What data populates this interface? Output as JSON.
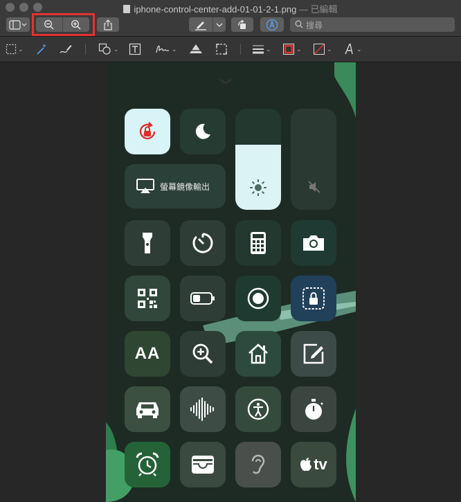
{
  "window": {
    "title": "iphone-control-center-add-01-01-2-1.png",
    "status": " — 已編輯"
  },
  "toolbar": {
    "search_placeholder": "搜尋",
    "highlight_color": "#e33232"
  },
  "control_center": {
    "mirror_label": "螢幕鏡像輸出",
    "rows": [
      [
        "flashlight-icon",
        "timer-icon",
        "calculator-icon",
        "camera-icon"
      ],
      [
        "qr-code-icon",
        "low-power-mode-icon",
        "screen-recording-icon",
        "guided-access-icon"
      ],
      [
        "text-size-icon",
        "magnifier-icon",
        "home-icon",
        "notes-icon"
      ],
      [
        "car-icon",
        "sound-recognition-icon",
        "accessibility-icon",
        "stopwatch-icon"
      ],
      [
        "alarm-icon",
        "wallet-icon",
        "hearing-icon",
        "apple-tv-remote-icon"
      ]
    ],
    "text_size_label": "AA",
    "apple_tv_label": "tv",
    "sliders": {
      "brightness_level": 0.64,
      "volume_level": 0.0
    }
  }
}
